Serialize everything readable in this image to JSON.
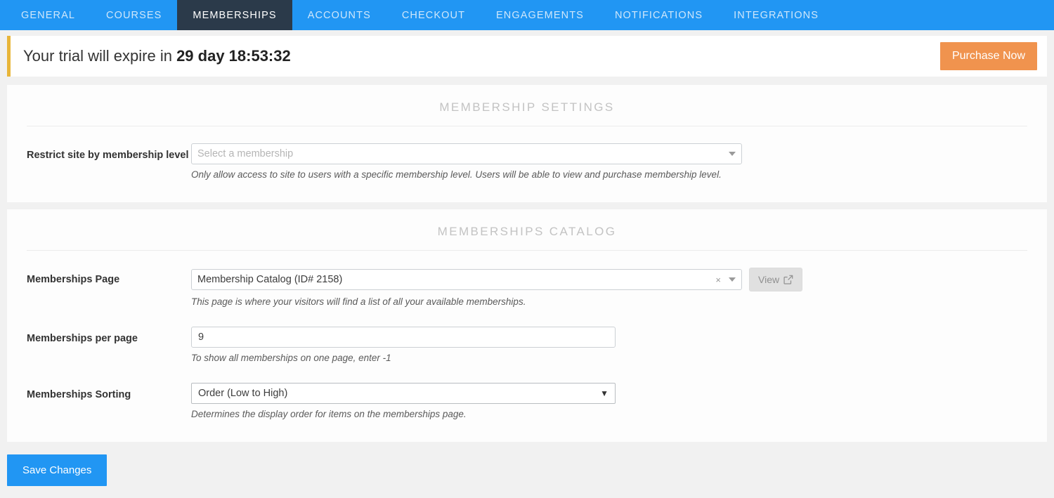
{
  "nav": {
    "tabs": [
      {
        "label": "GENERAL",
        "active": false
      },
      {
        "label": "COURSES",
        "active": false
      },
      {
        "label": "MEMBERSHIPS",
        "active": true
      },
      {
        "label": "ACCOUNTS",
        "active": false
      },
      {
        "label": "CHECKOUT",
        "active": false
      },
      {
        "label": "ENGAGEMENTS",
        "active": false
      },
      {
        "label": "NOTIFICATIONS",
        "active": false
      },
      {
        "label": "INTEGRATIONS",
        "active": false
      }
    ],
    "bar_color": "#2196f3",
    "active_color": "#2b3a4a"
  },
  "banner": {
    "prefix": "Your trial will expire in ",
    "countdown": "29 day 18:53:32",
    "purchase_label": "Purchase Now",
    "accent_color": "#e8b63a",
    "button_color": "#f0934e"
  },
  "settings_section": {
    "title": "MEMBERSHIP SETTINGS",
    "restrict": {
      "label": "Restrict site by membership level",
      "placeholder": "Select a membership",
      "value": "",
      "help": "Only allow access to site to users with a specific membership level. Users will be able to view and purchase membership level."
    }
  },
  "catalog_section": {
    "title": "MEMBERSHIPS CATALOG",
    "page": {
      "label": "Memberships Page",
      "value": "Membership Catalog (ID# 2158)",
      "clear_icon": "×",
      "view_label": "View",
      "help": "This page is where your visitors will find a list of all your available memberships."
    },
    "per_page": {
      "label": "Memberships per page",
      "value": "9",
      "help": "To show all memberships on one page, enter -1"
    },
    "sorting": {
      "label": "Memberships Sorting",
      "value": "Order (Low to High)",
      "arrow": "▼",
      "help": "Determines the display order for items on the memberships page."
    }
  },
  "footer": {
    "save_label": "Save Changes",
    "save_color": "#2196f3"
  }
}
